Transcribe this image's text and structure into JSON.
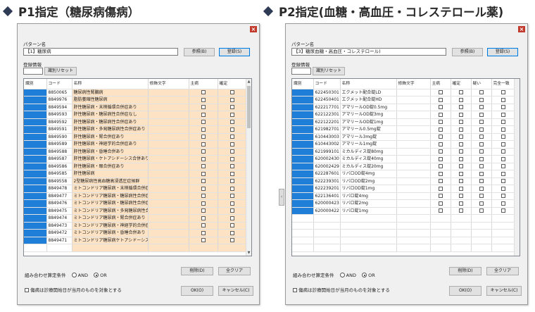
{
  "left": {
    "heading": "P1指定（糖尿病傷病）",
    "pattern_label": "パターン名",
    "pattern_value": "【1】糖尿病",
    "browse": "参照(B)",
    "register": "登録(S)",
    "reg_info": "登録情報",
    "reset": "識別リセット",
    "columns": [
      "識別",
      "コード",
      "名称",
      "修飾文字",
      "主病",
      "確定"
    ],
    "rows": [
      [
        "8850065",
        "糖尿病性腎臓病"
      ],
      [
        "8849976",
        "脂肪萎縮性糖尿病"
      ],
      [
        "8849594",
        "肝性糖尿病・末梢循環合併症あり"
      ],
      [
        "8849593",
        "肝性糖尿病・糖尿病性合併症なし"
      ],
      [
        "8849592",
        "肝性糖尿病・糖尿病性合併症あり"
      ],
      [
        "8849591",
        "肝性糖尿病・多発糖尿病性合併症あり"
      ],
      [
        "8849590",
        "肝性糖尿病・腎合併症あり"
      ],
      [
        "8849589",
        "肝性糖尿病・神経学的合併症あり"
      ],
      [
        "8849588",
        "肝性糖尿病・昏睡合併あり"
      ],
      [
        "8849587",
        "肝性糖尿病・ケトアシドーシス合併あり"
      ],
      [
        "8849586",
        "肝性糖尿病・眼合併症あり"
      ],
      [
        "8849585",
        "肝性糖尿病"
      ],
      [
        "8849558",
        "2型糖尿病性高血糖高浸透圧症候群"
      ],
      [
        "8849478",
        "ミトコンドリア糖尿病・末梢循環合併症あり"
      ],
      [
        "8849477",
        "ミトコンドリア糖尿病・糖尿病性合併症あり"
      ],
      [
        "8849476",
        "ミトコンドリア糖尿病・糖尿病性合併症なし"
      ],
      [
        "8849475",
        "ミトコンドリア糖尿病・多発糖尿病性合併症"
      ],
      [
        "8849474",
        "ミトコンドリア糖尿病・腎合併症あり"
      ],
      [
        "8849473",
        "ミトコンドリア糖尿病・神経学的合併症あり"
      ],
      [
        "8849472",
        "ミトコンドリア糖尿病・昏睡合併あり"
      ],
      [
        "8849471",
        "ミトコンドリア糖尿病ケトアシドーシス合併"
      ]
    ],
    "combo_label": "組み合わせ算定条件",
    "and": "AND",
    "or": "OR",
    "delete": "削除(D)",
    "clear_all": "全クリア",
    "checkbox_label": "傷病は診療開始日が当月のものを対象とする",
    "ok": "OK(O)",
    "cancel": "キャンセル(C)"
  },
  "right": {
    "heading": "P2指定(血糖・高血圧・コレステロール薬)",
    "pattern_label": "パターン名",
    "pattern_value": "【3】糖尿血糖・高血圧・コレステロール)",
    "browse": "参照(B)",
    "register": "登録(S)",
    "reg_info": "登録情報",
    "reset": "識別リセット",
    "columns": [
      "識別",
      "コード",
      "名称",
      "修飾文字",
      "主病",
      "確定",
      "疑い",
      "完全一致"
    ],
    "rows": [
      [
        "622450301",
        "エクメット配合錠LD"
      ],
      [
        "622450401",
        "エクメット配合錠HD"
      ],
      [
        "622217701",
        "アマリールOD錠0.5mg"
      ],
      [
        "622122301",
        "アマリールOD錠3mg"
      ],
      [
        "622122201",
        "アマリールOD錠1mg"
      ],
      [
        "621982701",
        "アマリール0.5mg錠"
      ],
      [
        "610443003",
        "アマリール3mg錠"
      ],
      [
        "610443002",
        "アマリール1mg錠"
      ],
      [
        "621999101",
        "ミカルディス錠80mg"
      ],
      [
        "620002430",
        "ミカルディス錠40mg"
      ],
      [
        "620002429",
        "ミカルディス錠20mg"
      ],
      [
        "622287601",
        "リバロOD錠4mg"
      ],
      [
        "622239301",
        "リバロOD錠2mg"
      ],
      [
        "622239201",
        "リバロOD錠1mg"
      ],
      [
        "622136401",
        "リバロ錠4mg"
      ],
      [
        "620000423",
        "リバロ錠2mg"
      ],
      [
        "620000422",
        "リバロ錠1mg"
      ]
    ],
    "combo_label": "組み合わせ算定条件",
    "and": "AND",
    "or": "OR",
    "delete": "削除(D)",
    "clear_all": "全クリア",
    "checkbox_label": "傷病は診療開始日が当月のものを対象とする",
    "ok": "OK(O)",
    "cancel": "キャンセル(C)"
  },
  "colors": {
    "selected_cell": "#1f7fd8",
    "name_highlight": "#fde3c4",
    "close_button": "#c0392b"
  },
  "icons": [
    "diamond-bullet-icon",
    "close-icon",
    "radio-icon",
    "checkbox-icon"
  ]
}
